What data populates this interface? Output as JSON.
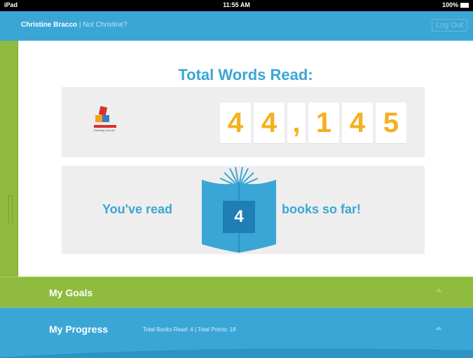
{
  "status_bar": {
    "device": "iPad",
    "time": "11:55 AM",
    "battery": "100%"
  },
  "header": {
    "user_name": "Christine Bracco",
    "not_user": "| Not Christine?",
    "logout_label": "Log Out"
  },
  "main": {
    "title": "Total Words Read:",
    "logo_text": "Reading Counts!",
    "words_read_digits": [
      "4",
      "4",
      ",",
      "1",
      "4",
      "5"
    ],
    "books_prefix": "You've read",
    "books_count": "4",
    "books_suffix": "books so far!"
  },
  "sections": {
    "goals": {
      "label": "My Goals"
    },
    "progress": {
      "label": "My Progress",
      "stats": "Total Books Read: 4  | Total Points: 18"
    }
  },
  "colors": {
    "blue": "#3aa6d6",
    "green": "#8fbc3f",
    "orange": "#f5b01d",
    "card": "#eeeeee"
  }
}
